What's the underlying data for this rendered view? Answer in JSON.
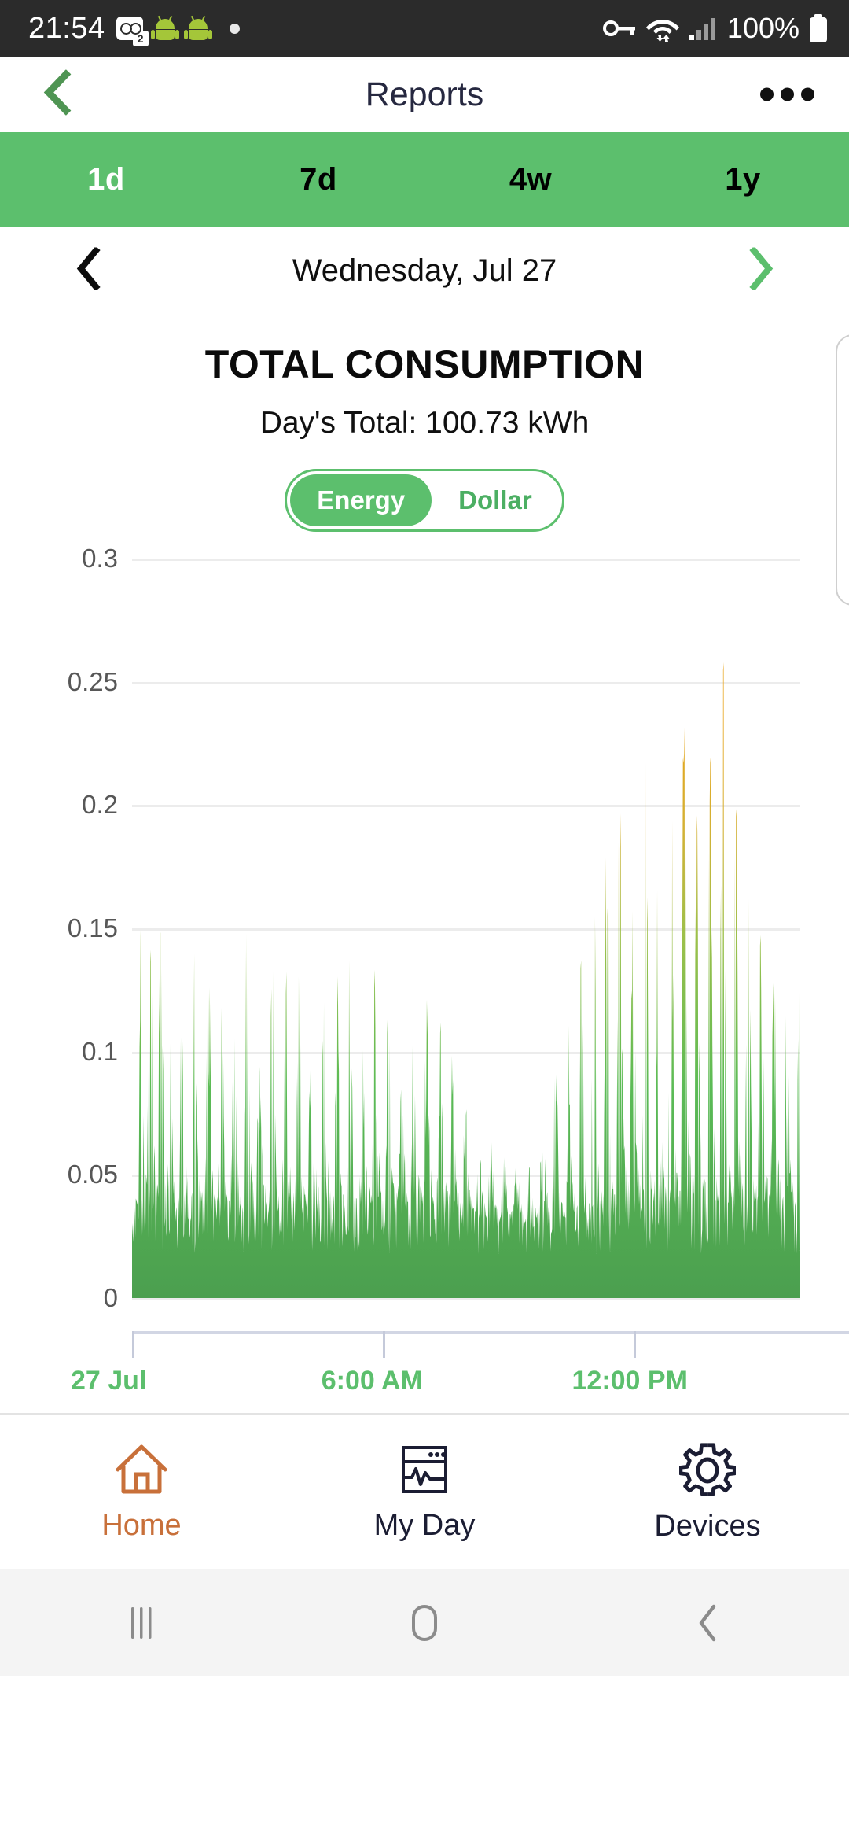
{
  "status_bar": {
    "time": "21:54",
    "voicemail_count": "2",
    "battery_percent": "100%",
    "icons": [
      "voicemail-icon",
      "android-robot-icon",
      "android-robot-icon",
      "dot-indicator-icon",
      "vpn-key-icon",
      "wifi-icon",
      "signal-bars-icon",
      "battery-full-icon"
    ]
  },
  "header": {
    "title": "Reports",
    "back_icon": "chevron-left-icon",
    "overflow_icon": "more-options-icon"
  },
  "range_tabs": {
    "items": [
      {
        "label": "1d",
        "active": true
      },
      {
        "label": "7d",
        "active": false
      },
      {
        "label": "4w",
        "active": false
      },
      {
        "label": "1y",
        "active": false
      }
    ]
  },
  "date_nav": {
    "prev_icon": "chevron-left-icon",
    "next_icon": "chevron-right-icon",
    "date": "Wednesday, Jul 27"
  },
  "summary": {
    "title": "TOTAL CONSUMPTION",
    "subtitle": "Day's Total: 100.73 kWh"
  },
  "unit_toggle": {
    "options": [
      {
        "label": "Energy",
        "selected": true
      },
      {
        "label": "Dollar",
        "selected": false
      }
    ]
  },
  "colors": {
    "brand_green": "#5cbf6d",
    "area_green": "#4caf50",
    "peak_orange": "#e8a317",
    "grid": "#ececec",
    "axis_label": "#575757",
    "nav_active": "#c8703a",
    "nav_inactive": "#1b1d33"
  },
  "chart_data": {
    "type": "area",
    "title": "TOTAL CONSUMPTION",
    "subtitle": "Day's Total: 100.73 kWh",
    "xlabel": "",
    "ylabel": "",
    "unit": "kWh",
    "grid": true,
    "legend": false,
    "ylim": [
      0,
      0.3
    ],
    "ytick_labels": [
      "0",
      "0.05",
      "0.1",
      "0.15",
      "0.2",
      "0.25",
      "0.3"
    ],
    "yticks": [
      0,
      0.05,
      0.1,
      0.15,
      0.2,
      0.25,
      0.3
    ],
    "xtick_labels": [
      "27 Jul",
      "6:00 AM",
      "12:00 PM"
    ],
    "xtick_positions": [
      0,
      0.375,
      0.75
    ],
    "xlim": [
      0,
      1
    ],
    "color_ramp": [
      {
        "value": 0.0,
        "color": "#4b9f4f"
      },
      {
        "value": 0.1,
        "color": "#5bbb56"
      },
      {
        "value": 0.17,
        "color": "#9dc04a"
      },
      {
        "value": 0.22,
        "color": "#d4b135"
      },
      {
        "value": 0.27,
        "color": "#e8a317"
      }
    ],
    "series": [
      {
        "name": "Total consumption",
        "values": [
          0.034,
          0.041,
          0.038,
          0.152,
          0.092,
          0.046,
          0.051,
          0.142,
          0.134,
          0.078,
          0.04,
          0.044,
          0.159,
          0.121,
          0.053,
          0.049,
          0.073,
          0.112,
          0.058,
          0.042,
          0.037,
          0.039,
          0.128,
          0.146,
          0.055,
          0.048,
          0.043,
          0.041,
          0.13,
          0.085,
          0.046,
          0.05,
          0.039,
          0.044,
          0.117,
          0.155,
          0.062,
          0.047,
          0.042,
          0.04,
          0.092,
          0.138,
          0.057,
          0.045,
          0.038,
          0.043,
          0.126,
          0.102,
          0.054,
          0.049,
          0.041,
          0.037,
          0.145,
          0.133,
          0.06,
          0.046,
          0.042,
          0.04,
          0.11,
          0.087,
          0.052,
          0.047,
          0.039,
          0.044,
          0.131,
          0.151,
          0.058,
          0.045,
          0.041,
          0.038,
          0.095,
          0.124,
          0.056,
          0.048,
          0.043,
          0.04,
          0.118,
          0.139,
          0.061,
          0.046,
          0.042,
          0.037,
          0.104,
          0.092,
          0.053,
          0.049,
          0.044,
          0.041,
          0.127,
          0.113,
          0.059,
          0.045,
          0.04,
          0.039,
          0.086,
          0.132,
          0.055,
          0.047,
          0.042,
          0.038,
          0.121,
          0.148,
          0.057,
          0.044,
          0.041,
          0.036,
          0.098,
          0.107,
          0.052,
          0.048,
          0.043,
          0.039,
          0.135,
          0.09,
          0.06,
          0.046,
          0.04,
          0.037,
          0.115,
          0.129,
          0.054,
          0.047,
          0.042,
          0.041,
          0.083,
          0.1,
          0.058,
          0.045,
          0.039,
          0.036,
          0.143,
          0.094,
          0.051,
          0.049,
          0.043,
          0.04,
          0.108,
          0.122,
          0.056,
          0.044,
          0.038,
          0.037,
          0.088,
          0.116,
          0.053,
          0.046,
          0.041,
          0.039,
          0.099,
          0.084,
          0.057,
          0.043,
          0.037,
          0.035,
          0.075,
          0.079,
          0.048,
          0.042,
          0.038,
          0.036,
          0.07,
          0.068,
          0.045,
          0.04,
          0.036,
          0.034,
          0.066,
          0.062,
          0.043,
          0.039,
          0.035,
          0.033,
          0.058,
          0.055,
          0.041,
          0.037,
          0.034,
          0.032,
          0.052,
          0.049,
          0.039,
          0.036,
          0.033,
          0.031,
          0.047,
          0.061,
          0.04,
          0.036,
          0.033,
          0.032,
          0.071,
          0.082,
          0.046,
          0.04,
          0.036,
          0.034,
          0.089,
          0.096,
          0.05,
          0.042,
          0.037,
          0.035,
          0.105,
          0.118,
          0.054,
          0.044,
          0.038,
          0.036,
          0.125,
          0.139,
          0.058,
          0.046,
          0.04,
          0.038,
          0.15,
          0.163,
          0.062,
          0.048,
          0.042,
          0.04,
          0.172,
          0.19,
          0.068,
          0.052,
          0.044,
          0.042,
          0.181,
          0.201,
          0.072,
          0.054,
          0.046,
          0.044,
          0.165,
          0.178,
          0.07,
          0.053,
          0.045,
          0.043,
          0.192,
          0.215,
          0.076,
          0.056,
          0.047,
          0.045,
          0.158,
          0.17,
          0.068,
          0.052,
          0.044,
          0.042,
          0.186,
          0.198,
          0.074,
          0.055,
          0.046,
          0.044,
          0.205,
          0.218,
          0.078,
          0.058,
          0.048,
          0.046,
          0.175,
          0.188,
          0.072,
          0.054,
          0.046,
          0.044,
          0.196,
          0.209,
          0.076,
          0.057,
          0.047,
          0.045,
          0.235,
          0.265,
          0.09,
          0.062,
          0.05,
          0.047,
          0.182,
          0.194,
          0.073,
          0.055,
          0.046,
          0.044,
          0.168,
          0.155,
          0.068,
          0.052,
          0.045,
          0.043,
          0.143,
          0.132,
          0.062,
          0.05,
          0.043,
          0.041,
          0.128,
          0.12,
          0.058,
          0.048,
          0.042,
          0.04,
          0.114,
          0.126,
          0.056,
          0.047,
          0.041,
          0.039,
          0.136,
          0.129
        ]
      }
    ]
  },
  "bottom_nav": {
    "items": [
      {
        "label": "Home",
        "icon": "home-icon",
        "active": true
      },
      {
        "label": "My Day",
        "icon": "my-day-icon",
        "active": false
      },
      {
        "label": "Devices",
        "icon": "gear-icon",
        "active": false
      }
    ]
  },
  "system_nav": {
    "recents_icon": "recents-icon",
    "home_icon": "home-circle-icon",
    "back_icon": "back-icon"
  }
}
